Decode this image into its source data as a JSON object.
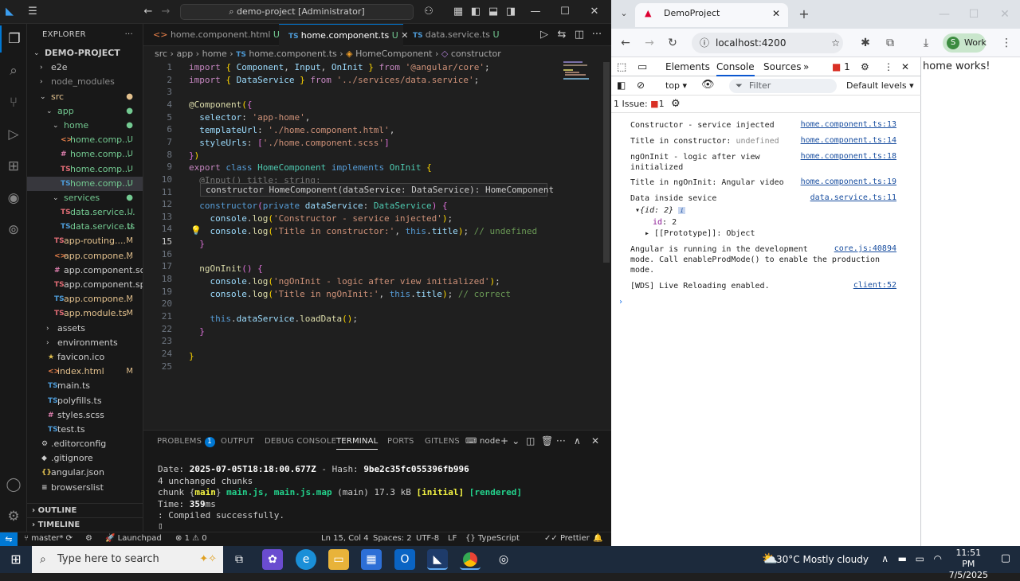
{
  "vscode": {
    "command_center": "demo-project [Administrator]",
    "explorer_title": "EXPLORER",
    "tree": [
      {
        "label": "DEMO-PROJECT",
        "depth": 0,
        "kind": "folder-open",
        "icon": "",
        "status": "",
        "bold": true
      },
      {
        "label": "e2e",
        "depth": 1,
        "kind": "folder",
        "icon": "",
        "status": ""
      },
      {
        "label": "node_modules",
        "depth": 1,
        "kind": "folder",
        "icon": "",
        "status": "",
        "dim": true
      },
      {
        "label": "src",
        "depth": 1,
        "kind": "folder-open",
        "icon": "",
        "status": "dot",
        "cls": "mod"
      },
      {
        "label": "app",
        "depth": 2,
        "kind": "folder-open",
        "icon": "",
        "status": "dot",
        "cls": "unt"
      },
      {
        "label": "home",
        "depth": 3,
        "kind": "folder-open",
        "icon": "",
        "status": "dot",
        "cls": "unt"
      },
      {
        "label": "home.comp...",
        "depth": 4,
        "kind": "file",
        "icon": "<>",
        "iconcls": "html",
        "status": "U",
        "cls": "unt"
      },
      {
        "label": "home.comp...",
        "depth": 4,
        "kind": "file",
        "icon": "#",
        "iconcls": "scss",
        "status": "U",
        "cls": "unt"
      },
      {
        "label": "home.comp...",
        "depth": 4,
        "kind": "file",
        "icon": "TS",
        "iconcls": "ang",
        "status": "U",
        "cls": "unt"
      },
      {
        "label": "home.comp...",
        "depth": 4,
        "kind": "file",
        "icon": "TS",
        "iconcls": "ts",
        "status": "U",
        "cls": "unt",
        "selected": true
      },
      {
        "label": "services",
        "depth": 3,
        "kind": "folder-open",
        "icon": "",
        "status": "dot",
        "cls": "unt"
      },
      {
        "label": "data.service....",
        "depth": 4,
        "kind": "file",
        "icon": "TS",
        "iconcls": "ang",
        "status": "U",
        "cls": "unt"
      },
      {
        "label": "data.service.ts",
        "depth": 4,
        "kind": "file",
        "icon": "TS",
        "iconcls": "ts",
        "status": "U",
        "cls": "unt"
      },
      {
        "label": "app-routing....",
        "depth": 3,
        "kind": "file",
        "icon": "TS",
        "iconcls": "ang",
        "status": "M",
        "cls": "mod"
      },
      {
        "label": "app.compone...",
        "depth": 3,
        "kind": "file",
        "icon": "<>",
        "iconcls": "html",
        "status": "M",
        "cls": "mod"
      },
      {
        "label": "app.component.scss",
        "depth": 3,
        "kind": "file",
        "icon": "#",
        "iconcls": "scss",
        "status": ""
      },
      {
        "label": "app.component.sp...",
        "depth": 3,
        "kind": "file",
        "icon": "TS",
        "iconcls": "ang",
        "status": ""
      },
      {
        "label": "app.compone...",
        "depth": 3,
        "kind": "file",
        "icon": "TS",
        "iconcls": "ts",
        "status": "M",
        "cls": "mod"
      },
      {
        "label": "app.module.ts",
        "depth": 3,
        "kind": "file",
        "icon": "TS",
        "iconcls": "ang",
        "status": "M",
        "cls": "mod"
      },
      {
        "label": "assets",
        "depth": 2,
        "kind": "folder",
        "icon": "",
        "status": ""
      },
      {
        "label": "environments",
        "depth": 2,
        "kind": "folder",
        "icon": "",
        "status": ""
      },
      {
        "label": "favicon.ico",
        "depth": 2,
        "kind": "file",
        "icon": "★",
        "iconcls": "ico-y",
        "status": ""
      },
      {
        "label": "index.html",
        "depth": 2,
        "kind": "file",
        "icon": "<>",
        "iconcls": "html",
        "status": "M",
        "cls": "mod"
      },
      {
        "label": "main.ts",
        "depth": 2,
        "kind": "file",
        "icon": "TS",
        "iconcls": "ts",
        "status": ""
      },
      {
        "label": "polyfills.ts",
        "depth": 2,
        "kind": "file",
        "icon": "TS",
        "iconcls": "ts",
        "status": ""
      },
      {
        "label": "styles.scss",
        "depth": 2,
        "kind": "file",
        "icon": "#",
        "iconcls": "scss",
        "status": ""
      },
      {
        "label": "test.ts",
        "depth": 2,
        "kind": "file",
        "icon": "TS",
        "iconcls": "ts",
        "status": ""
      },
      {
        "label": ".editorconfig",
        "depth": 1,
        "kind": "file",
        "icon": "⚙",
        "iconcls": "",
        "status": ""
      },
      {
        "label": ".gitignore",
        "depth": 1,
        "kind": "file",
        "icon": "◆",
        "iconcls": "",
        "status": ""
      },
      {
        "label": "angular.json",
        "depth": 1,
        "kind": "file",
        "icon": "{}",
        "iconcls": "ico-y",
        "status": ""
      },
      {
        "label": "browserslist",
        "depth": 1,
        "kind": "file",
        "icon": "≡",
        "iconcls": "",
        "status": ""
      }
    ],
    "outline_label": "OUTLINE",
    "timeline_label": "TIMELINE",
    "tabs": [
      {
        "label": "home.component.html",
        "status": "U",
        "icon": "<>",
        "iconcls": "html"
      },
      {
        "label": "home.component.ts",
        "status": "U",
        "icon": "TS",
        "iconcls": "ts",
        "active": true
      },
      {
        "label": "data.service.ts",
        "status": "U",
        "icon": "TS",
        "iconcls": "ts"
      }
    ],
    "breadcrumb": [
      "src",
      "app",
      "home",
      "home.component.ts",
      "HomeComponent",
      "constructor"
    ],
    "line_numbers": [
      "1",
      "2",
      "3",
      "4",
      "5",
      "6",
      "7",
      "8",
      "9",
      "10",
      "11",
      "12",
      "13",
      "14",
      "15",
      "16",
      "17",
      "18",
      "19",
      "20",
      "21",
      "22",
      "23",
      "24",
      "25"
    ],
    "hover_text": "constructor HomeComponent(dataService: DataService): HomeComponent",
    "panel_tabs": [
      "PROBLEMS",
      "OUTPUT",
      "DEBUG CONSOLE",
      "TERMINAL",
      "PORTS",
      "GITLENS"
    ],
    "problems_count": "1",
    "terminal_name": "node",
    "terminal_lines": {
      "date_label": "Date: ",
      "date_value": "2025-07-05T18:18:00.677Z",
      "hash_label": " - Hash: ",
      "hash_value": "9be2c35fc055396fb996",
      "l2": "4 unchanged chunks",
      "l3a": "chunk {",
      "l3b": "main",
      "l3c": "} ",
      "l3d": "main.js, main.js.map",
      "l3e": " (main) 17.3 kB ",
      "l3f": "[initial]",
      "l3g": " ",
      "l3h": "[rendered]",
      "l4a": "Time: ",
      "l4b": "359",
      "l4c": "ms",
      "l5": ": Compiled successfully."
    },
    "status": {
      "branch": "master*",
      "launchpad": "Launchpad",
      "errors": "1",
      "warnings": "0",
      "position": "Ln 15, Col 4",
      "spaces": "Spaces: 2",
      "encoding": "UTF-8",
      "eol": "LF",
      "language": "TypeScript",
      "prettier": "Prettier"
    }
  },
  "chrome": {
    "tab_title": "DemoProject",
    "url": "localhost:4200",
    "profile_initial": "S",
    "profile_label": "Work",
    "devtools_tabs": [
      "Elements",
      "Console",
      "Sources"
    ],
    "error_badge": "1",
    "context": "top",
    "filter_placeholder": "Filter",
    "levels": "Default levels",
    "issues_label": "1 Issue:",
    "issues_count": "1",
    "logs": [
      {
        "text": "Constructor - service injected",
        "src": "home.component.ts:13"
      },
      {
        "text": "Title in constructor: ",
        "extra": "undefined",
        "src": "home.component.ts:14"
      },
      {
        "text": "ngOnInit - logic after view\ninitialized",
        "src": "home.component.ts:18"
      },
      {
        "text": "Title in ngOnInit: Angular video",
        "src": "home.component.ts:19"
      },
      {
        "text": "Data inside sevice",
        "src": "data.service.ts:11"
      }
    ],
    "obj_summary": "{id: 2}",
    "obj_key": "id",
    "obj_val": "2",
    "obj_proto": "[[Prototype]]: Object",
    "angular_msg": "Angular is running in the development\nmode. Call enableProdMode() to enable the production\nmode.",
    "angular_src": "core.js:40894",
    "wds_msg": "[WDS] Live Reloading enabled.",
    "wds_src": "client:52",
    "page_text": "home works!"
  },
  "taskbar": {
    "search_placeholder": "Type here to search",
    "weather": "30°C  Mostly cloudy",
    "time": "11:51 PM",
    "date": "7/5/2025"
  }
}
